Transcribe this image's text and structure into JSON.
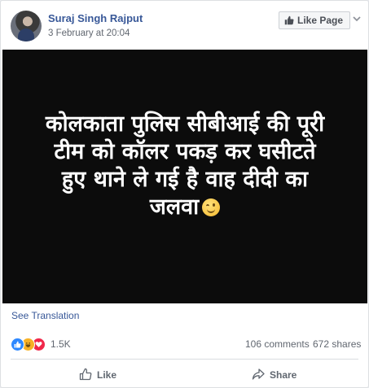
{
  "post": {
    "author": "Suraj Singh Rajput",
    "timestamp": "3 February at 20:04",
    "like_page_label": "Like Page",
    "image_text_lines": [
      "कोलकाता पुलिस सीबीआई की पूरी",
      "टीम को कॉलर पकड़ कर घसीटते",
      "हुए थाने ले गई है वाह दीदी का",
      "जलवा"
    ],
    "emoji": "winking-face",
    "see_translation": "See Translation"
  },
  "reactions": {
    "icons": [
      "like-icon",
      "haha-icon",
      "love-icon"
    ],
    "count": "1.5K",
    "comments": "106 comments",
    "shares": "672 shares"
  },
  "actions": {
    "like_label": "Like",
    "share_label": "Share"
  },
  "colors": {
    "link_blue": "#385898",
    "image_background": "#0c0c0c",
    "like_reaction": "#2d88ff",
    "haha_reaction": "#f7b125",
    "love_reaction": "#f0284a"
  }
}
